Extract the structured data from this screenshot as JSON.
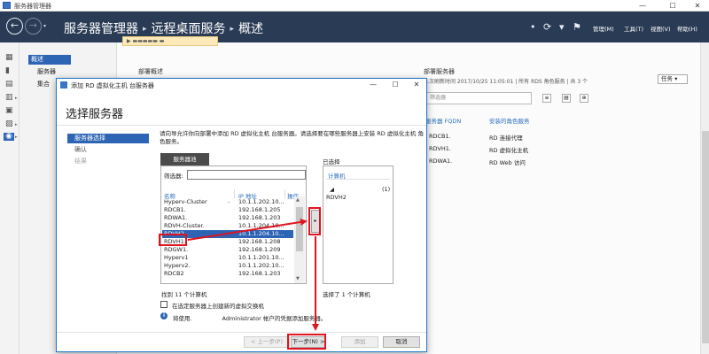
{
  "window": {
    "title": "服务器管理器",
    "min": "—",
    "max": "☐",
    "close": "✕"
  },
  "header": {
    "breadcrumb": [
      "服务器管理器",
      "远程桌面服务",
      "概述"
    ],
    "menus": [
      "管理(M)",
      "工具(T)",
      "视图(V)",
      "帮助(H)"
    ]
  },
  "nav": {
    "items": [
      "概述",
      "服务器",
      "集合"
    ]
  },
  "background": {
    "deploy_title": "部署概述",
    "servers_title": "部署服务器",
    "updated_text": "上次刷新时间 2017/10/25 11:05:01 | 所有 RDS 角色服务 | 共 3 个",
    "tasks_label": "任务 ▾",
    "filter_placeholder": "筛选器",
    "columns": [
      "服务器 FQDN",
      "安装的角色服务"
    ],
    "rows": [
      [
        "RDCB1.",
        "RD 连接代理"
      ],
      [
        "RDVH1.",
        "RD 虚拟化主机"
      ],
      [
        "RDWA1.",
        "RD Web 访问"
      ]
    ]
  },
  "dialog": {
    "title": "添加 RD 虚拟化主机 台服务器",
    "heading": "选择服务器",
    "steps": [
      "服务器选择",
      "确认",
      "结果"
    ],
    "description": "请向导允许你向部署中添加 RD 虚拟化主机 台服务器。请选择要在哪些服务器上安装 RD 虚拟化主机 角色服务。",
    "tab_label": "服务器池",
    "filter_label": "筛选器:",
    "columns": {
      "name": "名称",
      "ip": "IP 地址",
      "ops": "操作"
    },
    "rows": [
      {
        "name": "Hyperv-Cluster",
        "ip": "10.1.1.202.10..."
      },
      {
        "name": "RDCB1.",
        "ip": "192.168.1.205"
      },
      {
        "name": "RDWA1.",
        "ip": "192.168.1.203"
      },
      {
        "name": "RDVH-Cluster.",
        "ip": "10.1.1.204.10..."
      },
      {
        "name": "RDVH2.",
        "ip": "10.1.1.204.10...",
        "selected": true
      },
      {
        "name": "RDVH1.",
        "ip": "192.168.1.208"
      },
      {
        "name": "RDGW1.",
        "ip": "192.168.1.209"
      },
      {
        "name": "Hyperv1",
        "ip": "10.1.1.201.10..."
      },
      {
        "name": "Hyperv2.",
        "ip": "10.1.1.202.10..."
      },
      {
        "name": "RDCB2",
        "ip": "192.168.1.203"
      }
    ],
    "found_text": "找到 11 个计算机",
    "checkbox_label": "在选定服务器上创建新的虚拟交换机",
    "info_prefix": "将使用",
    "info_suffix": "Administrator 帐户的凭据添加服务器。",
    "move_label": "▸",
    "selected_title": "已选择",
    "selected_column": "计算机",
    "selected_group_count": "(1)",
    "selected_item": "RDVH2",
    "selected_count_text": "选择了 1 个计算机",
    "buttons": {
      "prev": "< 上一步(P)",
      "next": "下一步(N) >",
      "add": "添加",
      "cancel": "取消"
    }
  },
  "colors": {
    "header_bg": "#293b55",
    "accent_blue": "#2d64b4",
    "annotation_red": "#e0141e"
  }
}
